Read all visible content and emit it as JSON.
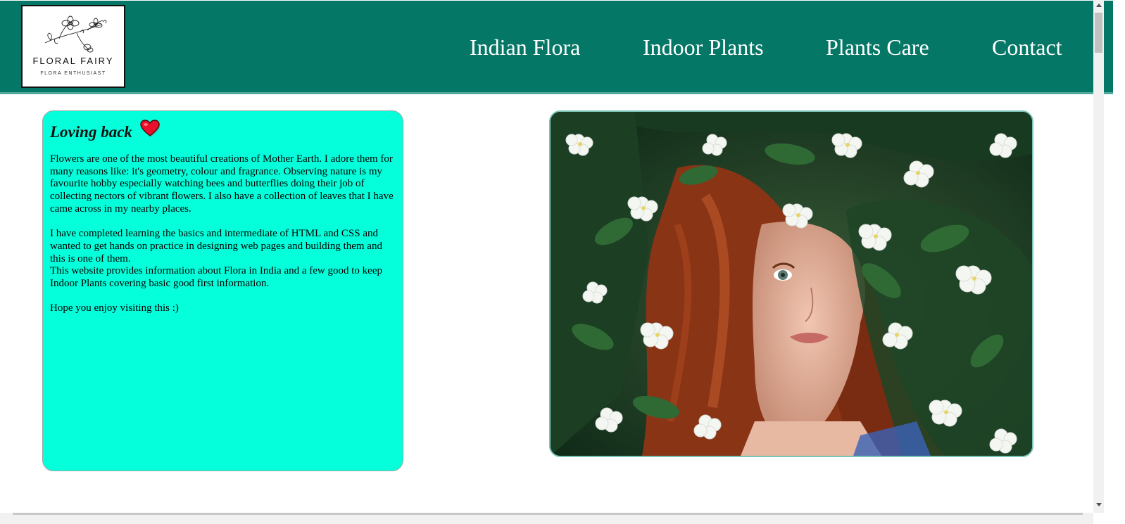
{
  "logo": {
    "title": "FLORAL FAIRY",
    "subtitle": "FLORA ENTHUSIAST"
  },
  "nav": [
    {
      "label": "Indian Flora"
    },
    {
      "label": "Indoor Plants"
    },
    {
      "label": "Plants Care"
    },
    {
      "label": "Contact"
    }
  ],
  "card": {
    "title": "Loving back",
    "icon": "heart-icon",
    "paragraphs": [
      "Flowers are one of the most beautiful creations of Mother Earth. I adore them for many reasons like: it's geometry, colour and fragrance. Observing nature is my favourite hobby especially watching bees and butterflies doing their job of collecting nectors of vibrant flowers. I also have a collection of leaves that I have came across in my nearby places.",
      "I have completed learning the basics and intermediate of HTML and CSS and wanted to get hands on practice in designing web pages and building them and this is one of them.",
      "This website provides information about Flora in India and a few good to keep Indoor Plants covering basic good first information.",
      "Hope you enjoy visiting this :)"
    ]
  },
  "colors": {
    "header": "#057766",
    "card": "#05ffdb",
    "heart": "#e8102a"
  }
}
